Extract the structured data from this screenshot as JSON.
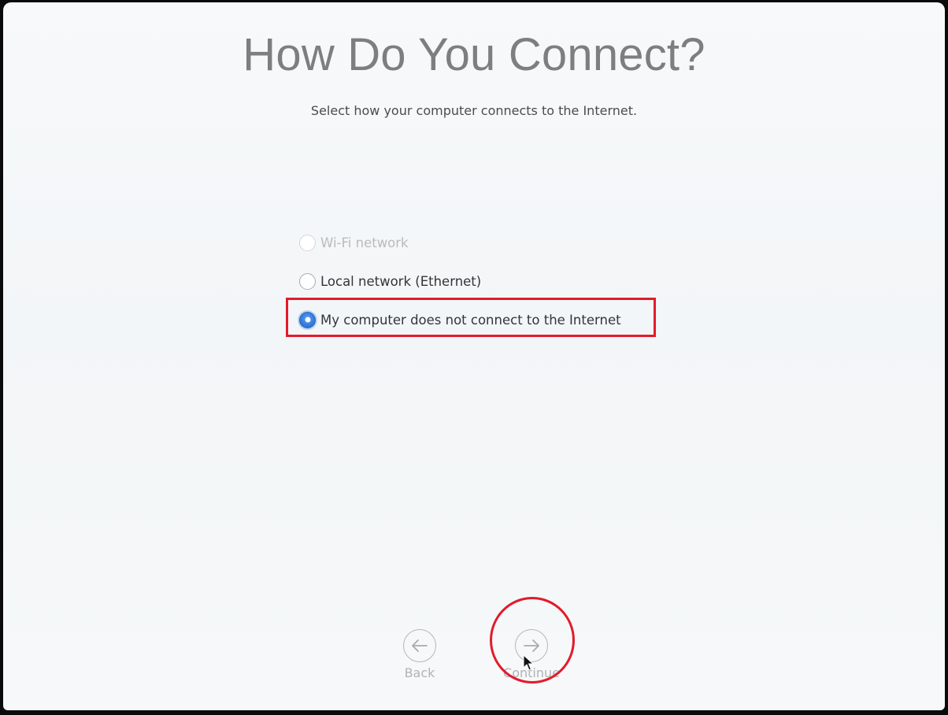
{
  "header": {
    "title": "How Do You Connect?",
    "subtitle": "Select how your computer connects to the Internet."
  },
  "options": [
    {
      "label": "Wi-Fi network",
      "state": "disabled"
    },
    {
      "label": "Local network (Ethernet)",
      "state": "unselected"
    },
    {
      "label": "My computer does not connect to the Internet",
      "state": "selected"
    }
  ],
  "nav": {
    "back_label": "Back",
    "back_icon": "arrow-left-icon",
    "continue_label": "Continue",
    "continue_icon": "arrow-right-icon"
  },
  "annotations": {
    "highlight_color": "#e21b2b",
    "accent_color": "#2f73d8"
  }
}
